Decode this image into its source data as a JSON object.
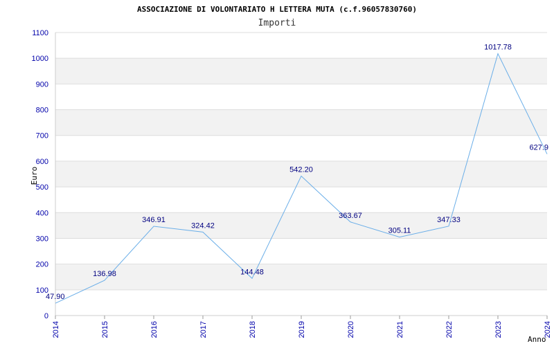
{
  "chart_data": {
    "type": "line",
    "title": "ASSOCIAZIONE DI VOLONTARIATO H LETTERA MUTA (c.f.96057830760)",
    "subtitle": "Importi",
    "xlabel": "Anno",
    "ylabel": "Euro",
    "categories": [
      "2014",
      "2015",
      "2016",
      "2017",
      "2018",
      "2019",
      "2020",
      "2021",
      "2022",
      "2023",
      "2024"
    ],
    "values": [
      47.9,
      136.98,
      346.91,
      324.42,
      144.48,
      542.2,
      363.67,
      305.11,
      347.33,
      1017.78,
      627.9
    ],
    "data_labels": [
      "47.90",
      "136.98",
      "346.91",
      "324.42",
      "144.48",
      "542.20",
      "363.67",
      "305.11",
      "347.33",
      "1017.78",
      "627.9"
    ],
    "ylim": [
      0,
      1100
    ],
    "yticks": [
      0,
      100,
      200,
      300,
      400,
      500,
      600,
      700,
      800,
      900,
      1000,
      1100
    ],
    "grid": "horizontal bands",
    "line_color": "#6aaee8",
    "band_color": "#f2f2f2"
  }
}
